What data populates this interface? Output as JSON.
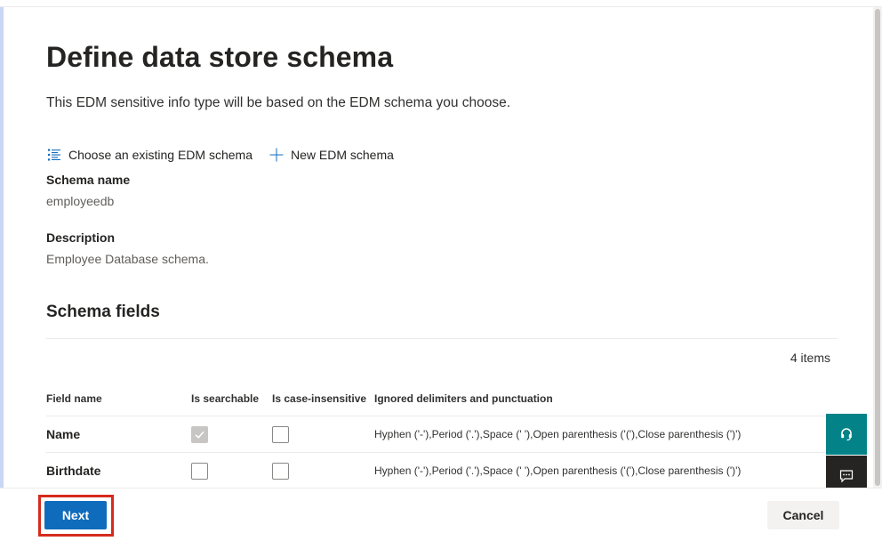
{
  "page": {
    "title": "Define data store schema",
    "subtitle": "This EDM sensitive info type will be based on the EDM schema you choose."
  },
  "actions": {
    "choose_existing": "Choose an existing EDM schema",
    "new_schema": "New EDM schema"
  },
  "schema": {
    "name_label": "Schema name",
    "name_value": "employeedb",
    "description_label": "Description",
    "description_value": "Employee Database schema."
  },
  "fields": {
    "section_title": "Schema fields",
    "item_count": "4 items",
    "columns": [
      "Field name",
      "Is searchable",
      "Is case-insensitive",
      "Ignored delimiters and punctuation"
    ],
    "rows": [
      {
        "name": "Name",
        "is_searchable": true,
        "is_searchable_disabled": true,
        "is_case_insensitive": false,
        "delimiters": "Hyphen ('-'),Period ('.'),Space (' '),Open parenthesis ('('),Close parenthesis (')')"
      },
      {
        "name": "Birthdate",
        "is_searchable": false,
        "is_searchable_disabled": false,
        "is_case_insensitive": false,
        "delimiters": "Hyphen ('-'),Period ('.'),Space (' '),Open parenthesis ('('),Close parenthesis (')')"
      }
    ]
  },
  "footer": {
    "next_label": "Next",
    "cancel_label": "Cancel"
  },
  "side_buttons": {
    "help_icon": "headset-icon",
    "feedback_icon": "feedback-icon"
  },
  "colors": {
    "primary": "#0f6cbd",
    "highlight": "#d52b1e",
    "help_bg": "#038387",
    "feedback_bg": "#252423"
  }
}
